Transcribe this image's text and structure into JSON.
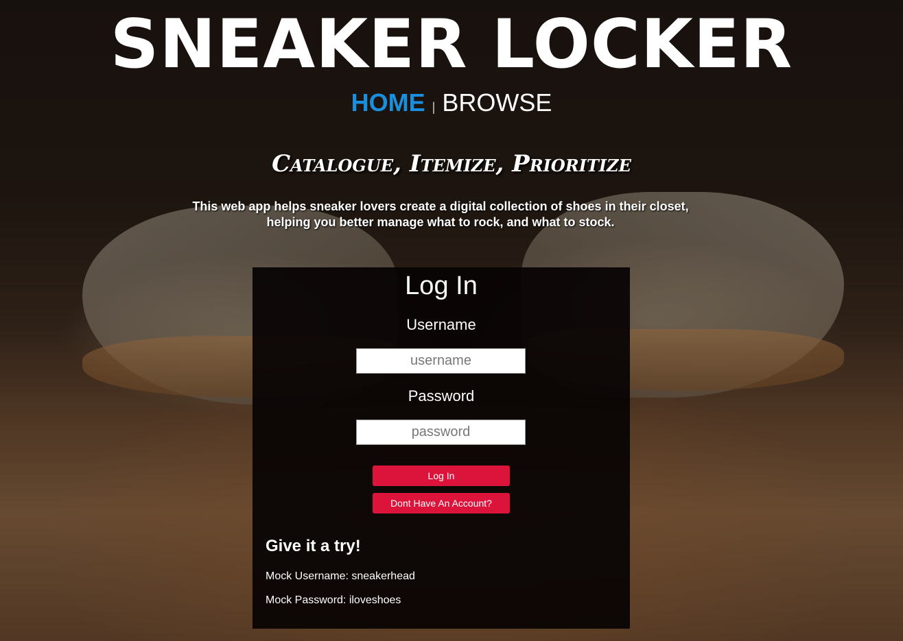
{
  "header": {
    "brand": "SNEAKER LOCKER",
    "nav": {
      "home": "HOME",
      "separator": "|",
      "browse": "BROWSE"
    }
  },
  "hero": {
    "tagline": "Catalogue, Itemize, Prioritize",
    "intro": "This web app helps sneaker lovers create a digital collection of shoes in their closet, helping you better manage what to rock, and what to stock."
  },
  "login": {
    "title": "Log In",
    "username_label": "Username",
    "username_placeholder": "username",
    "password_label": "Password",
    "password_placeholder": "password",
    "login_button": "Log In",
    "signup_button": "Dont Have An Account?",
    "try_title": "Give it a try!",
    "mock_username": "Mock Username: sneakerhead",
    "mock_password": "Mock Password: iloveshoes"
  },
  "colors": {
    "accent_blue": "#1a8fdd",
    "button_red": "#dc143c",
    "panel_bg": "#080303"
  }
}
